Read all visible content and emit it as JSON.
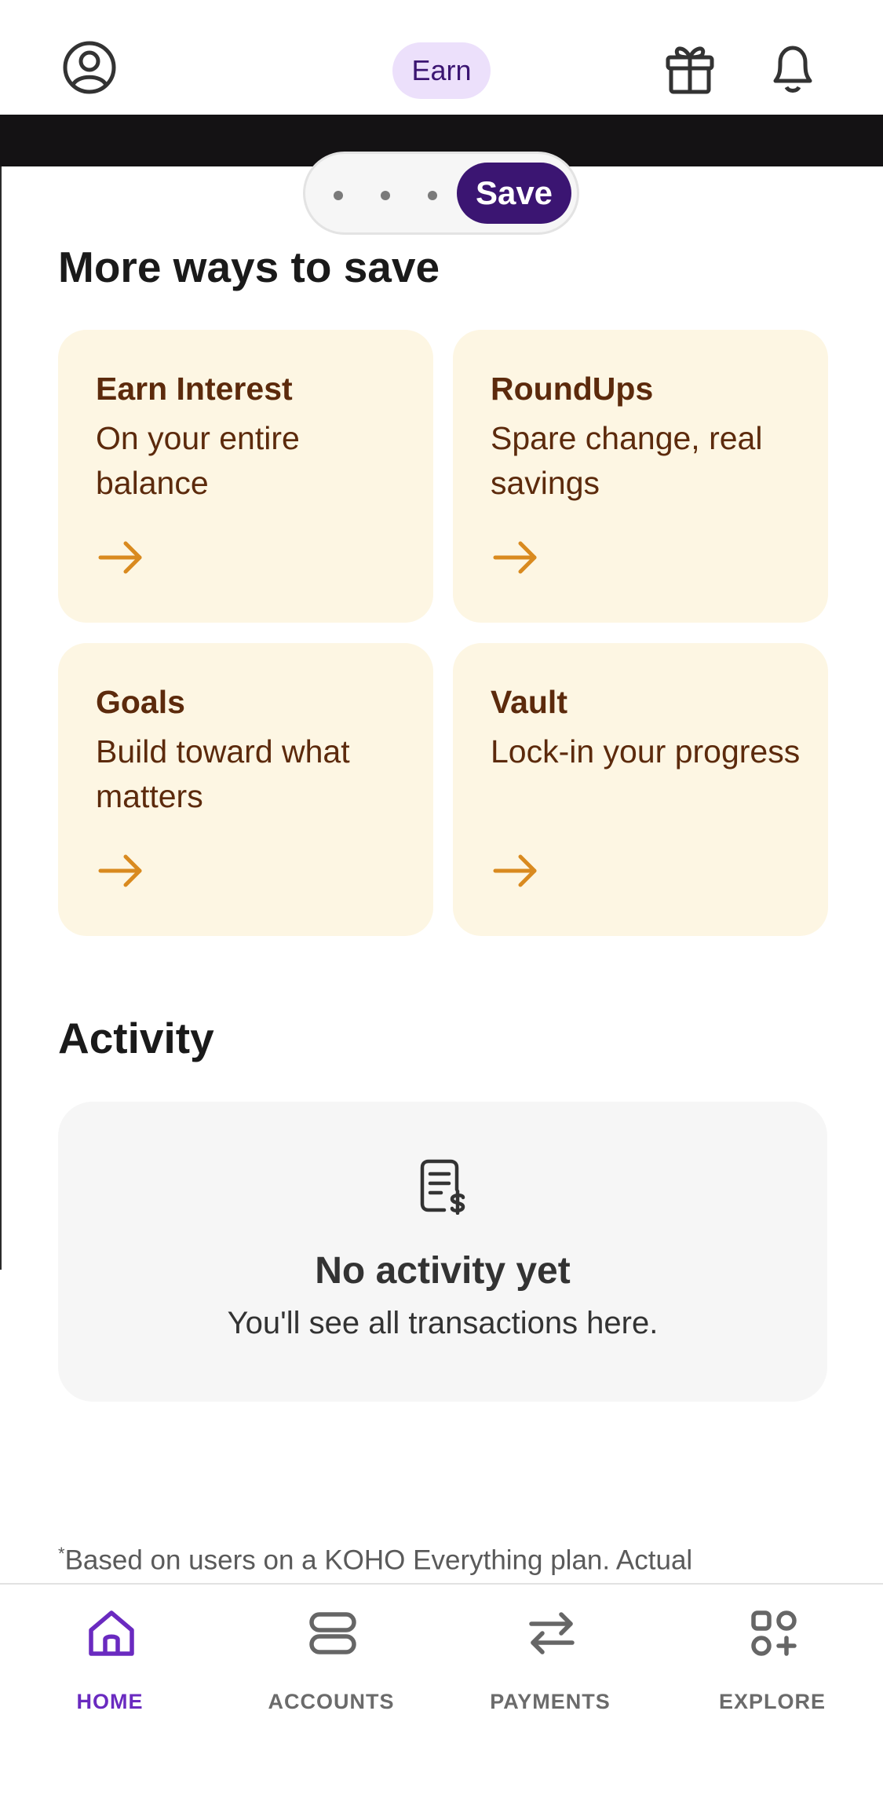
{
  "header": {
    "earn_label": "Earn"
  },
  "pager": {
    "active_label": "Save"
  },
  "save_section": {
    "title": "More ways to save",
    "cards": [
      {
        "title": "Earn Interest",
        "description": "On your entire balance"
      },
      {
        "title": "RoundUps",
        "description": "Spare change, real savings"
      },
      {
        "title": "Goals",
        "description": "Build toward what matters"
      },
      {
        "title": "Vault",
        "description": "Lock-in your progress"
      }
    ]
  },
  "activity": {
    "title": "Activity",
    "empty_title": "No activity yet",
    "empty_subtitle": "You'll see all transactions here."
  },
  "footnote": {
    "marker": "*",
    "text": "Based on users on a KOHO Everything plan. Actual"
  },
  "bottom_nav": {
    "items": [
      {
        "label": "HOME",
        "icon": "home-icon",
        "active": true
      },
      {
        "label": "ACCOUNTS",
        "icon": "accounts-icon",
        "active": false
      },
      {
        "label": "PAYMENTS",
        "icon": "transfer-icon",
        "active": false
      },
      {
        "label": "EXPLORE",
        "icon": "apps-plus-icon",
        "active": false
      }
    ]
  },
  "colors": {
    "brand_purple": "#3b1572",
    "active_nav": "#6a2ac0",
    "card_bg": "#fdf6e3",
    "card_text": "#5c2a0c",
    "arrow": "#d98a1f"
  }
}
